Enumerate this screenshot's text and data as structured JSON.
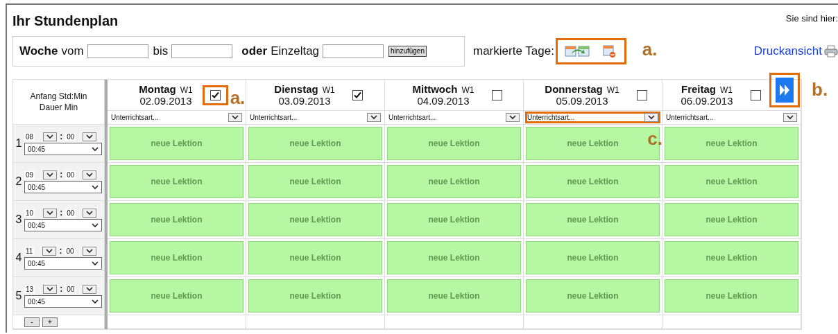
{
  "header": {
    "title": "Ihr Stundenplan",
    "breadcrumb": "Sie sind hier:"
  },
  "filter": {
    "week_label": "Woche",
    "from_label": "vom",
    "to_label": "bis",
    "or_label": "oder",
    "single_day_label": "Einzeltag",
    "add_button": "hinzufügen"
  },
  "marked_days": {
    "label": "markierte Tage:",
    "highlighted": true,
    "annotation": "a."
  },
  "print_link": "Druckansicht",
  "table": {
    "time_header": [
      "Anfang Std:Min",
      "Dauer Min"
    ],
    "days": [
      {
        "name": "Montag",
        "week": "W1",
        "date": "02.09.2013",
        "checked": true,
        "highlighted": true,
        "annotation": "a.",
        "lesson_type": "Unterrichtsart...",
        "type_highlighted": false
      },
      {
        "name": "Dienstag",
        "week": "W1",
        "date": "03.09.2013",
        "checked": true,
        "highlighted": false,
        "lesson_type": "Unterrichtsart...",
        "type_highlighted": false
      },
      {
        "name": "Mittwoch",
        "week": "W1",
        "date": "04.09.2013",
        "checked": false,
        "highlighted": false,
        "lesson_type": "Unterrichtsart...",
        "type_highlighted": false
      },
      {
        "name": "Donnerstag",
        "week": "W1",
        "date": "05.09.2013",
        "checked": false,
        "highlighted": false,
        "lesson_type": "Unterrichtsart...",
        "type_highlighted": true,
        "type_annotation": "c."
      },
      {
        "name": "Freitag",
        "week": "W1",
        "date": "06.09.2013",
        "checked": false,
        "highlighted": false,
        "lesson_type": "Unterrichtsart...",
        "type_highlighted": false
      }
    ],
    "next_button": {
      "highlighted": true,
      "annotation": "b."
    },
    "rows": [
      {
        "number": "1",
        "hour": "08",
        "minute": "00",
        "duration": "00:45",
        "lessons": [
          "neue Lektion",
          "neue Lektion",
          "neue Lektion",
          "neue Lektion",
          "neue Lektion"
        ]
      },
      {
        "number": "2",
        "hour": "09",
        "minute": "00",
        "duration": "00:45",
        "lessons": [
          "neue Lektion",
          "neue Lektion",
          "neue Lektion",
          "neue Lektion",
          "neue Lektion"
        ]
      },
      {
        "number": "3",
        "hour": "10",
        "minute": "00",
        "duration": "00:45",
        "lessons": [
          "neue Lektion",
          "neue Lektion",
          "neue Lektion",
          "neue Lektion",
          "neue Lektion"
        ]
      },
      {
        "number": "4",
        "hour": "11",
        "minute": "00",
        "duration": "00:45",
        "lessons": [
          "neue Lektion",
          "neue Lektion",
          "neue Lektion",
          "neue Lektion",
          "neue Lektion"
        ]
      },
      {
        "number": "5",
        "hour": "13",
        "minute": "00",
        "duration": "00:45",
        "lessons": [
          "neue Lektion",
          "neue Lektion",
          "neue Lektion",
          "neue Lektion",
          "neue Lektion"
        ]
      }
    ],
    "time_separator": ":",
    "remove_button": "-",
    "add_button": "+"
  }
}
